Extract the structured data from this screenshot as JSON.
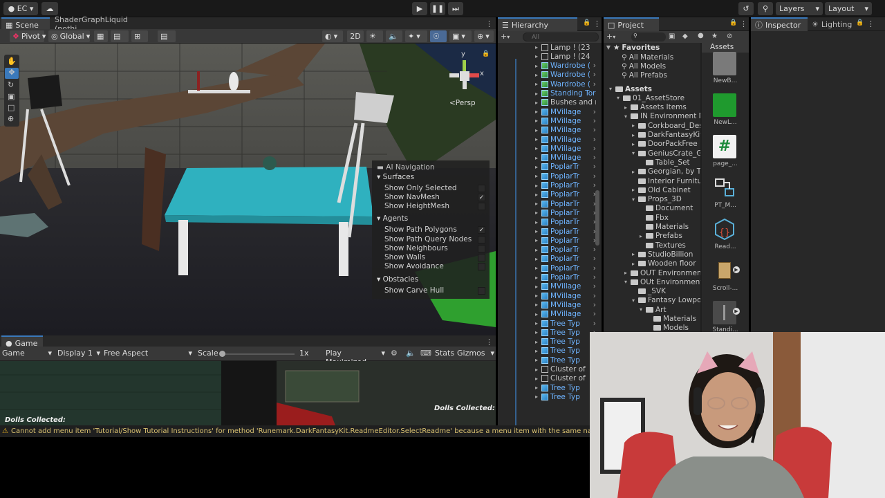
{
  "topbar": {
    "account": "EC",
    "layers": "Layers",
    "layout": "Layout"
  },
  "scene": {
    "tab": "Scene",
    "tab2": "ShaderGraphLiquid (nothi...",
    "pivot": "Pivot",
    "global": "Global",
    "mode_2d": "2D",
    "persp": "<Persp"
  },
  "ai_nav": {
    "title": "AI Navigation",
    "sections": [
      {
        "label": "Surfaces",
        "items": [
          {
            "label": "Show Only Selected",
            "checked": false
          },
          {
            "label": "Show NavMesh",
            "checked": true
          },
          {
            "label": "Show HeightMesh",
            "checked": false
          }
        ]
      },
      {
        "label": "Agents",
        "items": [
          {
            "label": "Show Path Polygons",
            "checked": true
          },
          {
            "label": "Show Path Query Nodes",
            "checked": false
          },
          {
            "label": "Show Neighbours",
            "checked": false
          },
          {
            "label": "Show Walls",
            "checked": false
          },
          {
            "label": "Show Avoidance",
            "checked": false
          }
        ]
      },
      {
        "label": "Obstacles",
        "items": [
          {
            "label": "Show Carve Hull",
            "checked": false
          }
        ]
      }
    ]
  },
  "game": {
    "tab": "Game",
    "mode": "Game",
    "display": "Display 1",
    "aspect": "Free Aspect",
    "scale_label": "Scale",
    "scale_value": "1x",
    "play": "Play Maximized",
    "stats": "Stats",
    "gizmos": "Gizmos",
    "dolls_left": "Dolls Collected:",
    "dolls_right": "Dolls Collected:"
  },
  "hierarchy": {
    "tab": "Hierarchy",
    "search_placeholder": "All",
    "rows": [
      {
        "label": "Lamp ! (23",
        "type": "obj",
        "blue": false
      },
      {
        "label": "Lamp ! (24",
        "type": "obj",
        "blue": false
      },
      {
        "label": "Wardrobe (",
        "type": "prefab",
        "blue": true
      },
      {
        "label": "Wardrobe (",
        "type": "prefab",
        "blue": true
      },
      {
        "label": "Wardrobe (",
        "type": "prefab",
        "blue": true
      },
      {
        "label": "Standing Torc",
        "type": "prefab",
        "blue": true
      },
      {
        "label": "Bushes and n",
        "type": "prefab",
        "blue": false
      },
      {
        "label": "MVillage",
        "type": "cube",
        "blue": true
      },
      {
        "label": "MVillage",
        "type": "cube",
        "blue": true
      },
      {
        "label": "MVillage",
        "type": "cube",
        "blue": true
      },
      {
        "label": "MVillage",
        "type": "cube",
        "blue": true
      },
      {
        "label": "MVillage",
        "type": "cube",
        "blue": true
      },
      {
        "label": "MVillage",
        "type": "cube",
        "blue": true
      },
      {
        "label": "PoplarTr",
        "type": "cube",
        "blue": true
      },
      {
        "label": "PoplarTr",
        "type": "cube",
        "blue": true
      },
      {
        "label": "PoplarTr",
        "type": "cube",
        "blue": true
      },
      {
        "label": "PoplarTr",
        "type": "cube",
        "blue": true
      },
      {
        "label": "PoplarTr",
        "type": "cube",
        "blue": true
      },
      {
        "label": "PoplarTr",
        "type": "cube",
        "blue": true
      },
      {
        "label": "PoplarTr",
        "type": "cube",
        "blue": true
      },
      {
        "label": "PoplarTr",
        "type": "cube",
        "blue": true
      },
      {
        "label": "PoplarTr",
        "type": "cube",
        "blue": true
      },
      {
        "label": "PoplarTr",
        "type": "cube",
        "blue": true
      },
      {
        "label": "PoplarTr",
        "type": "cube",
        "blue": true
      },
      {
        "label": "PoplarTr",
        "type": "cube",
        "blue": true
      },
      {
        "label": "PoplarTr",
        "type": "cube",
        "blue": true
      },
      {
        "label": "MVillage",
        "type": "cube",
        "blue": true
      },
      {
        "label": "MVillage",
        "type": "cube",
        "blue": true
      },
      {
        "label": "MVillage",
        "type": "cube",
        "blue": true
      },
      {
        "label": "MVillage",
        "type": "cube",
        "blue": true
      },
      {
        "label": "Tree Typ",
        "type": "cube",
        "blue": true
      },
      {
        "label": "Tree Typ",
        "type": "cube",
        "blue": true
      },
      {
        "label": "Tree Typ",
        "type": "cube",
        "blue": true
      },
      {
        "label": "Tree Typ",
        "type": "cube",
        "blue": true
      },
      {
        "label": "Tree Typ",
        "type": "cube",
        "blue": true
      },
      {
        "label": "Cluster of",
        "type": "obj",
        "blue": false
      },
      {
        "label": "Cluster of",
        "type": "obj",
        "blue": false
      },
      {
        "label": "Tree Typ",
        "type": "cube",
        "blue": true
      },
      {
        "label": "Tree Typ",
        "type": "cube",
        "blue": true
      }
    ]
  },
  "project": {
    "tab": "Project",
    "favorites": {
      "label": "Favorites",
      "items": [
        "All Materials",
        "All Models",
        "All Prefabs"
      ]
    },
    "assets_header": "Assets",
    "tree": [
      {
        "label": "Assets",
        "depth": 0,
        "arrow": "down"
      },
      {
        "label": "01_AssetStore",
        "depth": 1,
        "arrow": "down"
      },
      {
        "label": "Assets Items",
        "depth": 2,
        "arrow": "right"
      },
      {
        "label": "IN Environment M",
        "depth": 2,
        "arrow": "down"
      },
      {
        "label": "Corkboard_Desk",
        "depth": 3,
        "arrow": "right"
      },
      {
        "label": "DarkFantasyKit",
        "depth": 3,
        "arrow": "right"
      },
      {
        "label": "DoorPackFree",
        "depth": 3,
        "arrow": "right"
      },
      {
        "label": "GeniusCrate_Ga",
        "depth": 3,
        "arrow": "down"
      },
      {
        "label": "Table_Set",
        "depth": 4,
        "arrow": ""
      },
      {
        "label": "Georgian, by To",
        "depth": 3,
        "arrow": "right"
      },
      {
        "label": "Interior Furnitur",
        "depth": 3,
        "arrow": ""
      },
      {
        "label": "Old Cabinet",
        "depth": 3,
        "arrow": "right"
      },
      {
        "label": "Props_3D",
        "depth": 3,
        "arrow": "down"
      },
      {
        "label": "Document",
        "depth": 4,
        "arrow": ""
      },
      {
        "label": "Fbx",
        "depth": 4,
        "arrow": ""
      },
      {
        "label": "Materials",
        "depth": 4,
        "arrow": ""
      },
      {
        "label": "Prefabs",
        "depth": 4,
        "arrow": "right"
      },
      {
        "label": "Textures",
        "depth": 4,
        "arrow": ""
      },
      {
        "label": "StudioBillion",
        "depth": 3,
        "arrow": "right"
      },
      {
        "label": "Wooden floor",
        "depth": 3,
        "arrow": "right"
      },
      {
        "label": "OUT Environment",
        "depth": 2,
        "arrow": "right"
      },
      {
        "label": "OUt Environment I",
        "depth": 2,
        "arrow": "down"
      },
      {
        "label": "_SVK",
        "depth": 3,
        "arrow": ""
      },
      {
        "label": "Fantasy Lowpo",
        "depth": 3,
        "arrow": "down"
      },
      {
        "label": "Art",
        "depth": 4,
        "arrow": "down"
      },
      {
        "label": "Materials",
        "depth": 5,
        "arrow": ""
      },
      {
        "label": "Models",
        "depth": 5,
        "arrow": ""
      }
    ],
    "assets": [
      {
        "label": "NewB...",
        "color": "#7a7a7a"
      },
      {
        "label": "NewL...",
        "color": "#1f9a2e"
      },
      {
        "label": "page_...",
        "color": "#f2f2f2"
      },
      {
        "label": "PT_M...",
        "color": "#2b2b2b"
      },
      {
        "label": "Read...",
        "color": "#2b2b2b"
      },
      {
        "label": "Scroll-...",
        "color": "#c9a66b"
      },
      {
        "label": "Standi...",
        "color": "#4a4a4a"
      }
    ]
  },
  "inspector": {
    "tab": "Inspector",
    "tab2": "Lighting"
  },
  "console": {
    "warning": "Cannot add menu item 'Tutorial/Show Tutorial Instructions' for method 'Runemark.DarkFantasyKit.ReadmeEditor.SelectReadme' because a menu item with the same name alre"
  },
  "colors": {
    "accent": "#3a79bb",
    "warning": "#e6b020",
    "table_top": "#2fb1bf",
    "panel": "#383838"
  }
}
